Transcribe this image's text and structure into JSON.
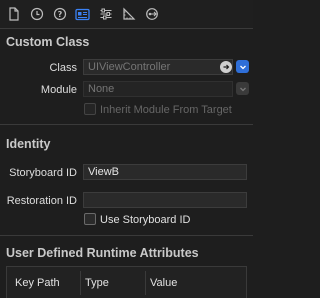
{
  "toolbar": {
    "tabs": [
      {
        "icon": "file-icon"
      },
      {
        "icon": "history-clock-icon"
      },
      {
        "icon": "quick-help-icon"
      },
      {
        "icon": "identity-inspector-icon",
        "active": true
      },
      {
        "icon": "attributes-sliders-icon"
      },
      {
        "icon": "size-ruler-icon"
      },
      {
        "icon": "connections-arrow-icon"
      }
    ],
    "accent": "#2f6fd8"
  },
  "custom_class": {
    "title": "Custom Class",
    "class_label": "Class",
    "class_placeholder": "UIViewController",
    "module_label": "Module",
    "module_placeholder": "None",
    "inherit_label": "Inherit Module From Target"
  },
  "identity": {
    "title": "Identity",
    "storyboard_id_label": "Storyboard ID",
    "storyboard_id_value": "ViewB",
    "restoration_id_label": "Restoration ID",
    "restoration_id_value": "",
    "use_storyboard_id_label": "Use Storyboard ID"
  },
  "runtime_attributes": {
    "title": "User Defined Runtime Attributes",
    "columns": [
      "Key Path",
      "Type",
      "Value"
    ]
  }
}
